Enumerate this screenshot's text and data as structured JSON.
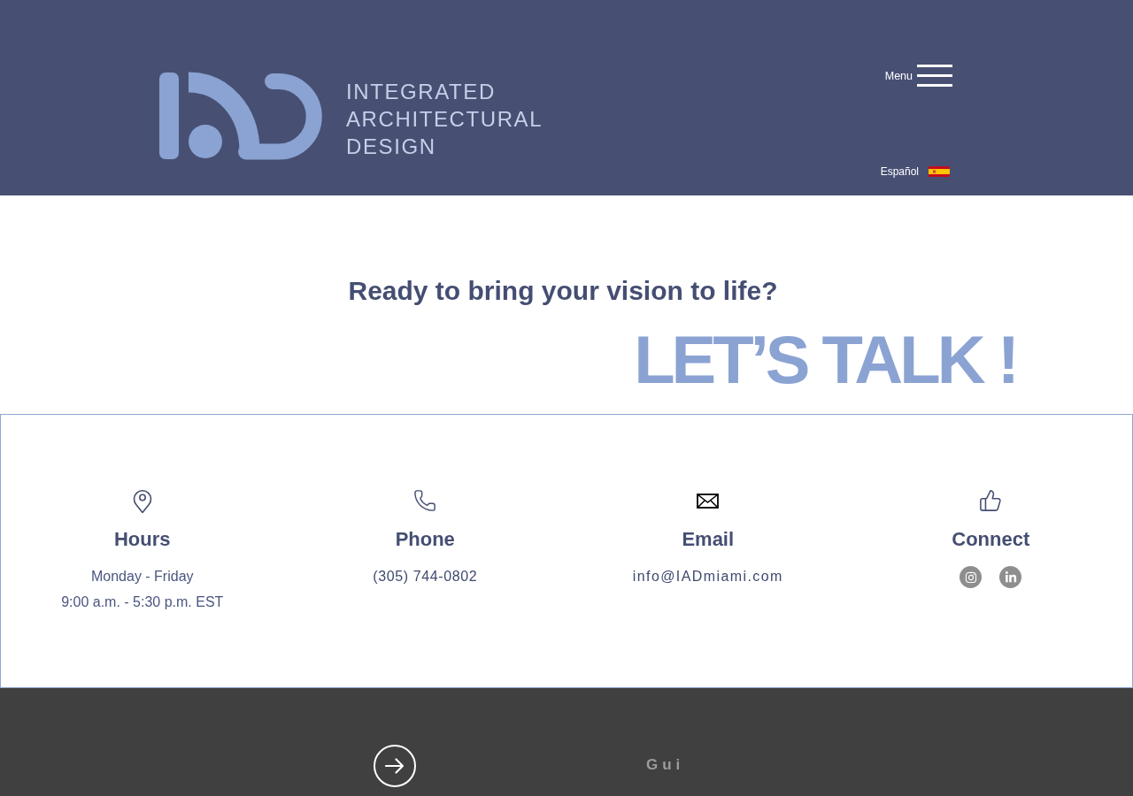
{
  "header": {
    "logo_text": [
      "INTEGRATED",
      "ARCHITECTURAL",
      "DESIGN"
    ],
    "menu_label": "Menu",
    "language_label": "Español"
  },
  "cta": {
    "heading": "Ready to bring your vision to life?",
    "title": "LET’S TALK !"
  },
  "contact_columns": [
    {
      "kind": "location",
      "title": "Hours",
      "lines": [
        "Monday - Friday",
        "9:00 a.m. - 5:30 p.m. EST"
      ]
    },
    {
      "kind": "phone",
      "title": "Phone",
      "lines": [
        "(305) 744-0802"
      ]
    },
    {
      "kind": "email",
      "title": "Email",
      "lines": [
        "info@IADmiami.com"
      ]
    },
    {
      "kind": "social",
      "title": "Connect"
    }
  ],
  "footer": {
    "label": "Gui"
  }
}
